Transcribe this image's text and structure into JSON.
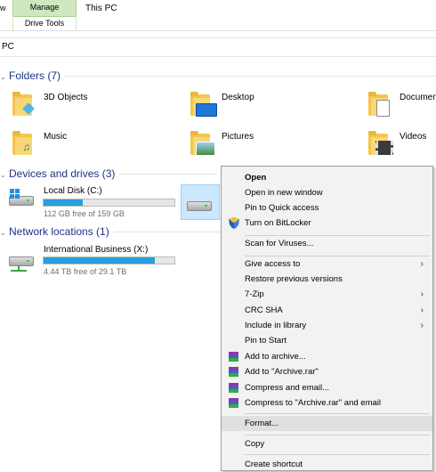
{
  "ribbon": {
    "left_fragment": "w",
    "manage_tab": "Manage",
    "drive_tools": "Drive Tools",
    "window_title": "This PC"
  },
  "address_bar": {
    "path_fragment": "PC"
  },
  "groups": {
    "folders": "Folders (7)",
    "devices": "Devices and drives (3)",
    "network": "Network locations (1)"
  },
  "folders": [
    {
      "label": "3D Objects",
      "icon": "3d-objects-folder-icon"
    },
    {
      "label": "Desktop",
      "icon": "desktop-folder-icon"
    },
    {
      "label": "Documen",
      "icon": "documents-folder-icon"
    },
    {
      "label": "Music",
      "icon": "music-folder-icon"
    },
    {
      "label": "Pictures",
      "icon": "pictures-folder-icon"
    },
    {
      "label": "Videos",
      "icon": "videos-folder-icon"
    }
  ],
  "drives": [
    {
      "label": "Local Disk (C:)",
      "free": "112 GB free of 159 GB",
      "used_fraction": 0.3
    }
  ],
  "network_locations": [
    {
      "label": "International Business (X:)",
      "free": "4.44 TB free of 29.1 TB",
      "used_fraction": 0.85
    }
  ],
  "context_menu": {
    "items": [
      {
        "label": "Open",
        "bold": true
      },
      {
        "label": "Open in new window"
      },
      {
        "label": "Pin to Quick access"
      },
      {
        "label": "Turn on BitLocker",
        "icon": "shield-icon"
      },
      {
        "label": "Scan for Viruses..."
      },
      {
        "label": "Give access to",
        "submenu": true
      },
      {
        "label": "Restore previous versions"
      },
      {
        "label": "7-Zip",
        "submenu": true
      },
      {
        "label": "CRC SHA",
        "submenu": true
      },
      {
        "label": "Include in library",
        "submenu": true
      },
      {
        "label": "Pin to Start"
      },
      {
        "label": "Add to archive...",
        "icon": "winrar-icon"
      },
      {
        "label": "Add to \"Archive.rar\"",
        "icon": "winrar-icon"
      },
      {
        "label": "Compress and email...",
        "icon": "winrar-icon"
      },
      {
        "label": "Compress to \"Archive.rar\" and email",
        "icon": "winrar-icon"
      },
      {
        "label": "Format..."
      },
      {
        "label": "Copy"
      },
      {
        "label": "Create shortcut"
      }
    ],
    "submenu_arrow": "›"
  },
  "colors": {
    "group_header": "#1e3287",
    "progress_fill": "#26a0da",
    "selection": "#cce8ff",
    "manage_tab": "#cfe8c0"
  }
}
